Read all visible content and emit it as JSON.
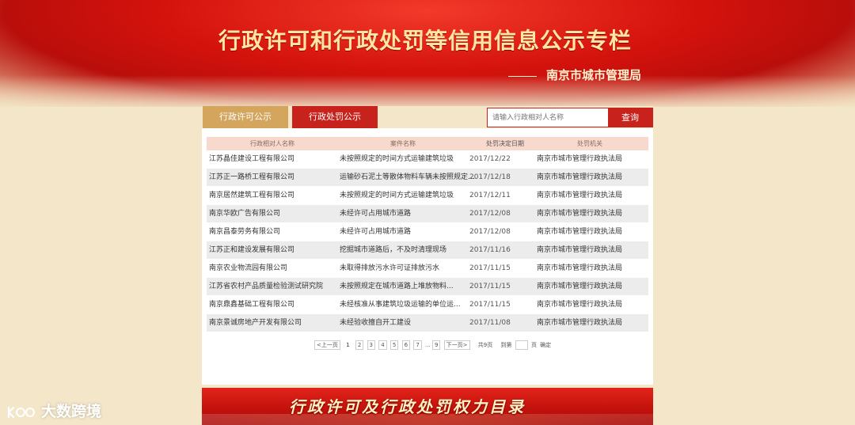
{
  "banner": {
    "title": "行政许可和行政处罚等信用信息公示专栏",
    "subtitle": "南京市城市管理局"
  },
  "tabs": [
    {
      "label": "行政许可公示"
    },
    {
      "label": "行政处罚公示"
    }
  ],
  "search": {
    "placeholder": "请输入行政相对人名称",
    "button_label": "查询"
  },
  "table": {
    "headers": [
      "行政相对人名称",
      "案件名称",
      "处罚决定日期",
      "处罚机关"
    ],
    "rows": [
      [
        "江苏晶佳建设工程有限公司",
        "未按照规定的时间方式运输建筑垃圾",
        "2017/12/22",
        "南京市城市管理行政执法局"
      ],
      [
        "江苏正一路桥工程有限公司",
        "运输砂石泥土等散体物料车辆未按照规定采取...",
        "2017/12/18",
        "南京市城市管理行政执法局"
      ],
      [
        "南京居然建筑工程有限公司",
        "未按照规定的时间方式运输建筑垃圾",
        "2017/12/11",
        "南京市城市管理行政执法局"
      ],
      [
        "南京华欧广告有限公司",
        "未经许可占用城市道路",
        "2017/12/08",
        "南京市城市管理行政执法局"
      ],
      [
        "南京昌泰劳务有限公司",
        "未经许可占用城市道路",
        "2017/12/08",
        "南京市城市管理行政执法局"
      ],
      [
        "江苏正和建设发展有限公司",
        "挖掘城市道路后，不及时清理现场",
        "2017/11/16",
        "南京市城市管理行政执法局"
      ],
      [
        "南京农业物流园有限公司",
        "未取得排放污水许可证排放污水",
        "2017/11/15",
        "南京市城市管理行政执法局"
      ],
      [
        "江苏省农村产品质量检验测试研究院",
        "未按照规定在城市道路上堆放物料...",
        "2017/11/15",
        "南京市城市管理行政执法局"
      ],
      [
        "南京鼎鑫基础工程有限公司",
        "未经核准从事建筑垃圾运输的单位运...",
        "2017/11/15",
        "南京市城市管理行政执法局"
      ],
      [
        "南京景诚房地产开发有限公司",
        "未经验收擅自开工建设",
        "2017/11/08",
        "南京市城市管理行政执法局"
      ]
    ]
  },
  "pager": {
    "prev": "<上一页",
    "pages": [
      "1",
      "2",
      "3",
      "4",
      "5",
      "6",
      "7"
    ],
    "ellipsis": "...",
    "last": "9",
    "next": "下一页>",
    "total": "共9页",
    "goto_label": "到第",
    "page_suffix": "页",
    "confirm": "确定"
  },
  "bottom_banner": {
    "title": "行政许可及行政处罚权力目录"
  },
  "watermark": {
    "text": "大数跨境"
  },
  "colors": {
    "brand_red": "#c7221b",
    "tab_gold": "#d4a55c",
    "background": "#f3e6c9"
  }
}
